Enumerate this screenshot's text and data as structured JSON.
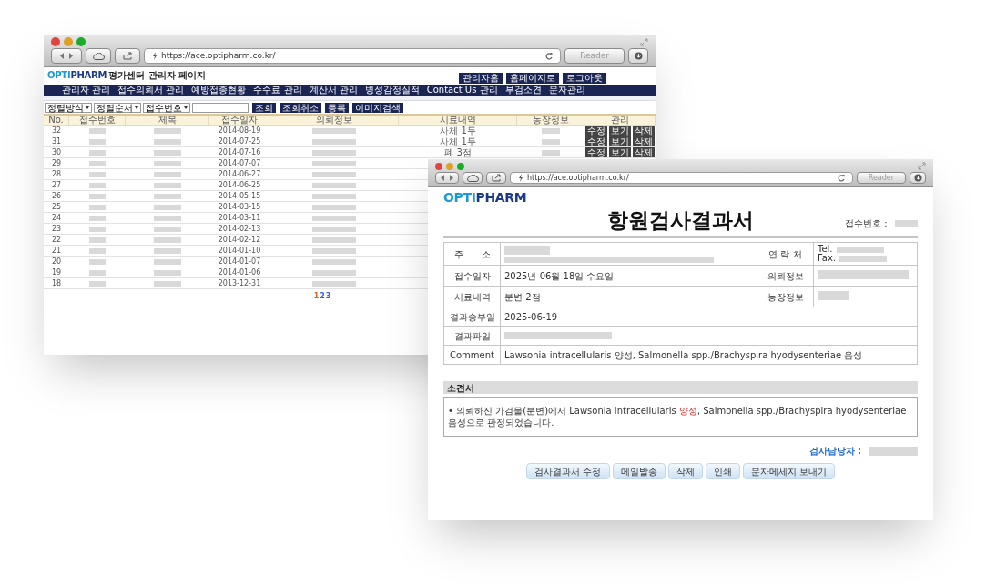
{
  "back_window": {
    "url": "https://ace.optipharm.co.kr/",
    "reader": "Reader",
    "logo": {
      "part1": "OPTI",
      "part2": "PHARM"
    },
    "site_title": "평가센터 관리자 페이지",
    "top_buttons": [
      "관리자홈",
      "홈페이지로",
      "로그아웃"
    ],
    "nav": [
      "관리자 관리",
      "접수의뢰서 관리",
      "예방접종현황",
      "수수료 관리",
      "계산서 관리",
      "병성감정실적",
      "Contact Us 관리",
      "부검소견",
      "문자관리"
    ],
    "filters": [
      "정렬방식",
      "정렬순서",
      "접수번호"
    ],
    "filter_buttons": [
      "조회",
      "조회취소",
      "등록",
      "이미지검색"
    ],
    "columns": [
      "No.",
      "접수번호",
      "제목",
      "접수일자",
      "의뢰정보",
      "시료내역",
      "농장정보",
      "관리"
    ],
    "rows": [
      {
        "no": "32",
        "date": "2014-08-19",
        "sample": "사체 1두",
        "actions": [
          "수정",
          "보기",
          "삭제"
        ]
      },
      {
        "no": "31",
        "date": "2014-07-25",
        "sample": "사체 1두",
        "actions": [
          "수정",
          "보기",
          "삭제"
        ]
      },
      {
        "no": "30",
        "date": "2014-07-16",
        "sample": "폐 3점",
        "actions": [
          "수정",
          "보기",
          "삭제"
        ]
      },
      {
        "no": "29",
        "date": "2014-07-07"
      },
      {
        "no": "28",
        "date": "2014-06-27"
      },
      {
        "no": "27",
        "date": "2014-06-25"
      },
      {
        "no": "26",
        "date": "2014-05-15"
      },
      {
        "no": "25",
        "date": "2014-03-15"
      },
      {
        "no": "24",
        "date": "2014-03-11"
      },
      {
        "no": "23",
        "date": "2014-02-13"
      },
      {
        "no": "22",
        "date": "2014-02-12"
      },
      {
        "no": "21",
        "date": "2014-01-10"
      },
      {
        "no": "20",
        "date": "2014-01-07"
      },
      {
        "no": "19",
        "date": "2014-01-06"
      },
      {
        "no": "18",
        "date": "2013-12-31"
      }
    ],
    "pages": [
      {
        "label": "1",
        "selected": true
      },
      {
        "label": "2",
        "selected": false
      },
      {
        "label": "3",
        "selected": false
      }
    ]
  },
  "front_window": {
    "url": "https://ace.optipharm.co.kr/",
    "reader": "Reader",
    "logo": {
      "part1": "OPTI",
      "part2": "PHARM"
    },
    "title": "항원검사결과서",
    "receipt_label": "접수번호 :",
    "address_label": "주　　소",
    "contact_label": "연 락 처",
    "tel_label": "Tel.",
    "fax_label": "Fax.",
    "fields": [
      {
        "label": "접수일자",
        "value": "2025년 06월 18일 수요일",
        "side_label": "의뢰정보"
      },
      {
        "label": "시료내역",
        "value": "분변 2점",
        "side_label": "농장정보"
      },
      {
        "label": "결과송부일",
        "value": "2025-06-19"
      },
      {
        "label": "결과파일"
      },
      {
        "label": "Comment",
        "value": "Lawsonia intracellularis 양성, Salmonella spp./Brachyspira hyodysenteriae 음성"
      }
    ],
    "opinion_title": "소견서",
    "opinion": [
      {
        "text": "• 의뢰하신 가검물(분변)에서 Lawsonia intracellularis ",
        "kind": "normal"
      },
      {
        "text": "양성",
        "kind": "positive"
      },
      {
        "text": ", Salmonella spp./Brachyspira hyodysenteriae 음성으로 판정되었습니다.",
        "kind": "normal"
      }
    ],
    "inspector_label": "검사담당자 :",
    "buttons": [
      "검사결과서 수정",
      "메일발송",
      "삭제",
      "인쇄",
      "문자메세지 보내기"
    ]
  }
}
